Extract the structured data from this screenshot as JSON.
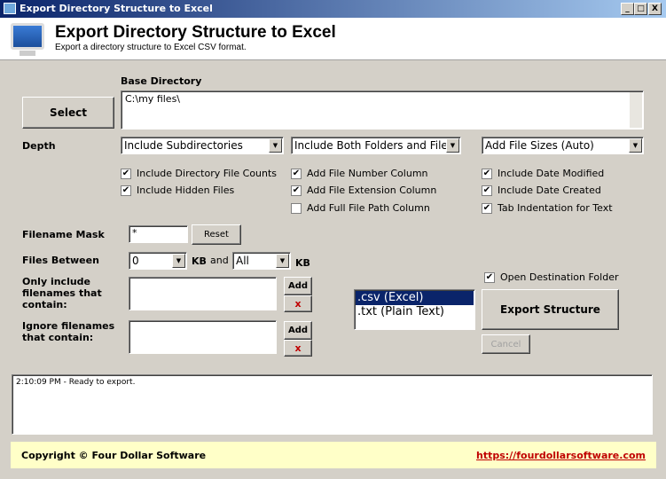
{
  "window": {
    "title": "Export Directory Structure to Excel",
    "minimize": "_",
    "maximize": "□",
    "close": "X"
  },
  "header": {
    "title": "Export Directory Structure to Excel",
    "subtitle": "Export a directory structure to Excel CSV format."
  },
  "base_directory": {
    "label": "Base Directory",
    "value": "C:\\my files\\",
    "select_label": "Select"
  },
  "depth": {
    "label": "Depth",
    "dropdowns": [
      "Include Subdirectories",
      "Include Both Folders and Files",
      "Add File Sizes (Auto)"
    ]
  },
  "options": [
    {
      "label": "Include Directory File Counts",
      "checked": true
    },
    {
      "label": "Include Hidden Files",
      "checked": true
    },
    {
      "label": "Add File Number Column",
      "checked": true
    },
    {
      "label": "Add File Extension Column",
      "checked": true
    },
    {
      "label": "Add Full File Path Column",
      "checked": false
    },
    {
      "label": "Include Date Modified",
      "checked": true
    },
    {
      "label": "Include Date Created",
      "checked": true
    },
    {
      "label": "Tab Indentation for Text",
      "checked": true
    }
  ],
  "filename_mask": {
    "label": "Filename Mask",
    "value": "*",
    "reset_label": "Reset"
  },
  "files_between": {
    "label": "Files Between",
    "min": "0",
    "unit1": "KB",
    "and": "and",
    "max": "All",
    "unit2": "KB"
  },
  "include": {
    "label": "Only include filenames that contain:",
    "add": "Add",
    "remove": "x"
  },
  "ignore": {
    "label": "Ignore filenames that contain:",
    "add": "Add",
    "remove": "x"
  },
  "formats": {
    "items": [
      ".csv (Excel)",
      ".txt (Plain Text)"
    ],
    "selected": ".csv (Excel)"
  },
  "open_destination": {
    "label": "Open Destination Folder",
    "checked": true
  },
  "export_label": "Export Structure",
  "cancel_label": "Cancel",
  "log": "2:10:09 PM - Ready to export.",
  "footer": {
    "copyright": "Copyright © Four Dollar Software",
    "link": "https://fourdollarsoftware.com"
  },
  "colors": {
    "selection": "#0a246a",
    "link": "#c00000",
    "footer_bg": "#ffffc8"
  }
}
